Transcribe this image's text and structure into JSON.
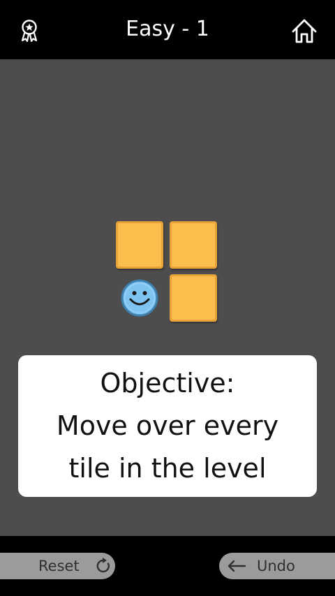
{
  "header": {
    "level_title": "Easy - 1",
    "left_icon": "award-ribbon-icon",
    "right_icon": "home-icon"
  },
  "board": {
    "background_color": "#4d4d4d",
    "tile_color": "#fbbd4c",
    "tile_border_color": "#e8a238",
    "player_color": "#7ec4f1",
    "tiles": [
      {
        "row": 0,
        "col": 0,
        "type": "tile"
      },
      {
        "row": 0,
        "col": 1,
        "type": "tile"
      },
      {
        "row": 1,
        "col": 0,
        "type": "player"
      },
      {
        "row": 1,
        "col": 1,
        "type": "tile"
      }
    ]
  },
  "objective": {
    "line1": "Objective:",
    "line2": "Move over every",
    "line3": "tile in the level"
  },
  "footer": {
    "reset_label": "Reset",
    "reset_icon": "refresh-icon",
    "undo_label": "Undo",
    "undo_icon": "arrow-left-icon"
  }
}
